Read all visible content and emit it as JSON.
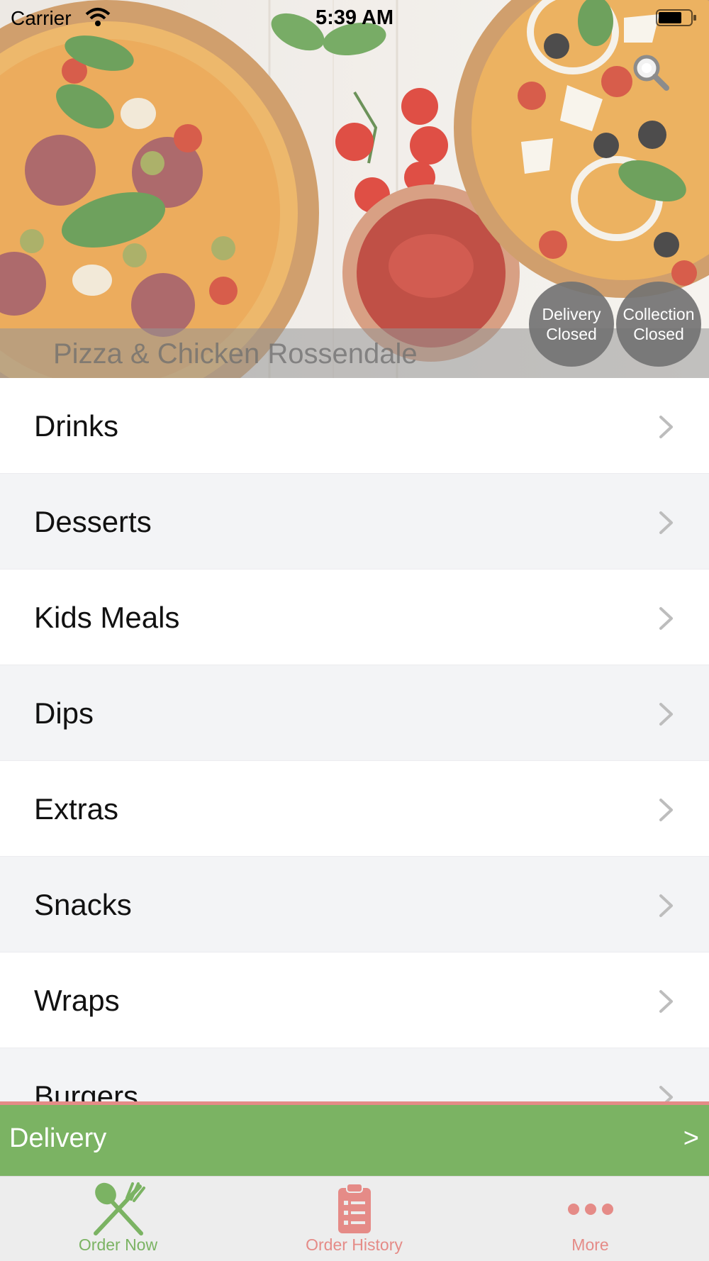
{
  "status_bar": {
    "carrier": "Carrier",
    "time": "5:39 AM"
  },
  "header": {
    "restaurant_name": "Pizza & Chicken Rossendale",
    "search_icon": "search-icon",
    "delivery_status": {
      "line1": "Delivery",
      "line2": "Closed"
    },
    "collection_status": {
      "line1": "Collection",
      "line2": "Closed"
    }
  },
  "menu": {
    "items": [
      {
        "label": "Drinks"
      },
      {
        "label": "Desserts"
      },
      {
        "label": "Kids Meals"
      },
      {
        "label": "Dips"
      },
      {
        "label": "Extras"
      },
      {
        "label": "Snacks"
      },
      {
        "label": "Wraps"
      },
      {
        "label": "Burgers"
      }
    ],
    "chevron_icon": "chevron-right-icon"
  },
  "order_type_bar": {
    "label": "Delivery",
    "arrow": ">"
  },
  "tab_bar": {
    "tabs": [
      {
        "label": "Order Now",
        "icon": "fork-knife-icon"
      },
      {
        "label": "Order History",
        "icon": "clipboard-icon"
      },
      {
        "label": "More",
        "icon": "more-dots-icon"
      }
    ]
  },
  "colors": {
    "accent_green": "#7bb363",
    "accent_pink": "#e58b87",
    "row_alt": "#f3f4f6"
  }
}
